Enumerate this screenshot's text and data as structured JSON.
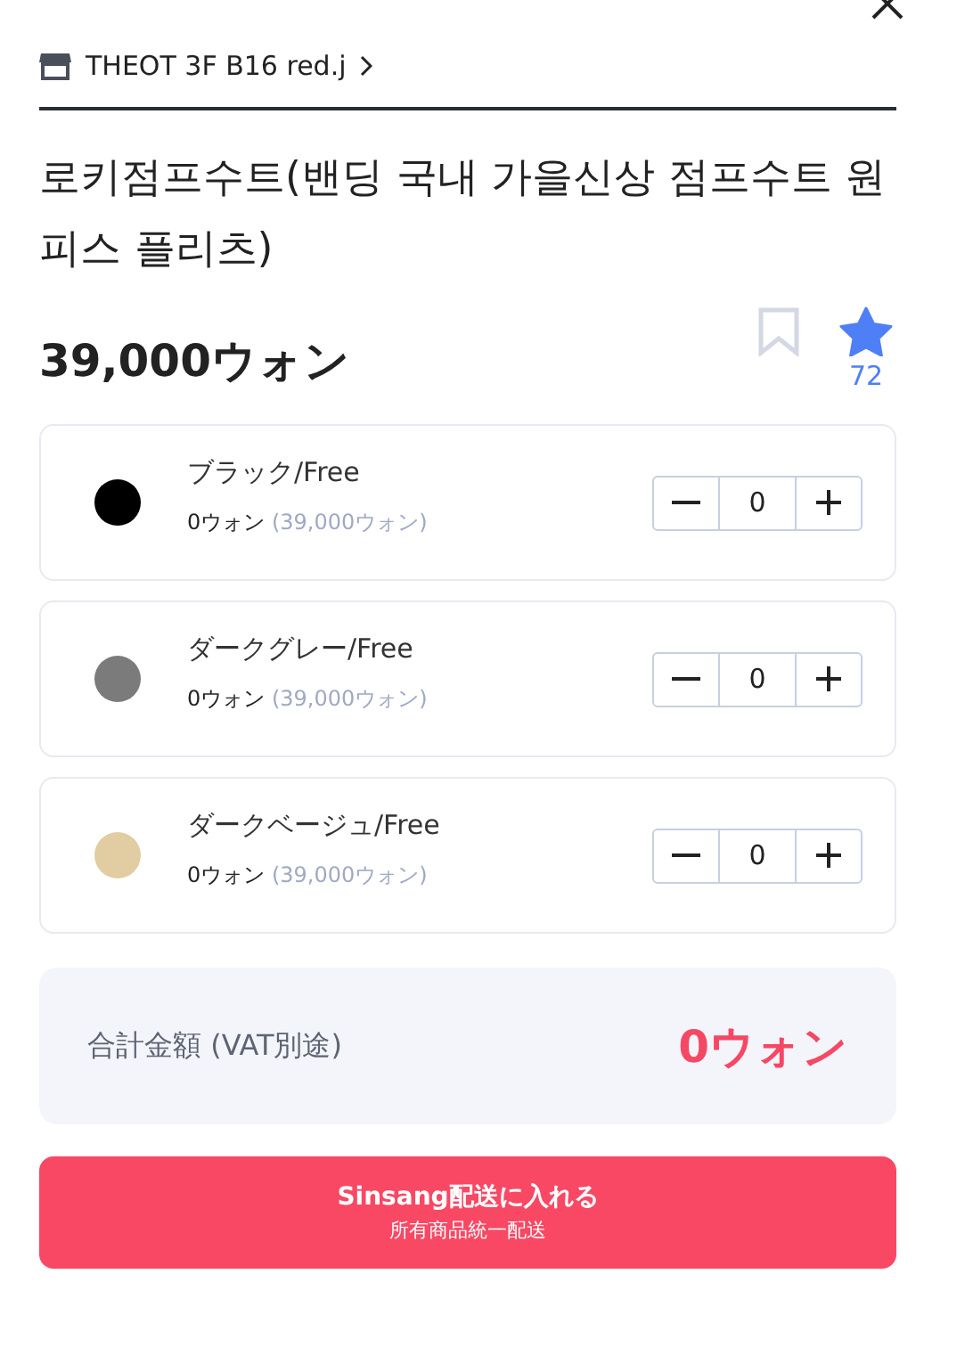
{
  "store": {
    "name": "THEOT 3F B16 red.j"
  },
  "product": {
    "title": "로키점프수트(밴딩 국내 가을신상 점프수트 원피스 플리츠)",
    "price": "39,000ウォン"
  },
  "bookmark": {
    "selected": false
  },
  "like": {
    "selected": true,
    "count": "72"
  },
  "options": [
    {
      "name": "ブラック/Free",
      "color": "#000000",
      "subtotal": "0ウォン",
      "unit_price": "(39,000ウォン)",
      "quantity": "0"
    },
    {
      "name": "ダークグレー/Free",
      "color": "#7b7b7b",
      "subtotal": "0ウォン",
      "unit_price": "(39,000ウォン)",
      "quantity": "0"
    },
    {
      "name": "ダークベージュ/Free",
      "color": "#e2cda3",
      "subtotal": "0ウォン",
      "unit_price": "(39,000ウォン)",
      "quantity": "0"
    }
  ],
  "total": {
    "label": "合計金額 (VAT別途)",
    "value": "0ウォン"
  },
  "cta": {
    "label": "Sinsang配送に入れる",
    "sublabel": "所有商品統一配送"
  }
}
